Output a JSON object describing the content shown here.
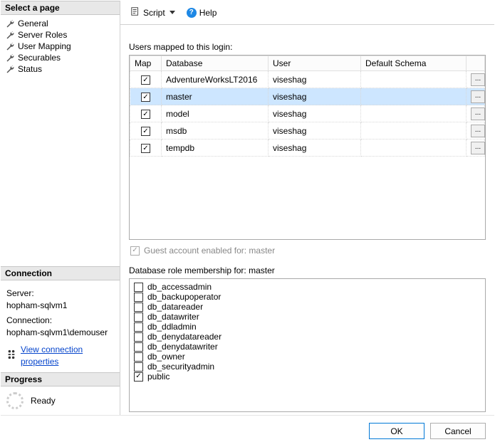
{
  "left": {
    "select_page_header": "Select a page",
    "pages": [
      "General",
      "Server Roles",
      "User Mapping",
      "Securables",
      "Status"
    ],
    "selected_index": 2,
    "connection_header": "Connection",
    "server_label": "Server:",
    "server_value": "hopham-sqlvm1",
    "connection_label": "Connection:",
    "connection_value": "hopham-sqlvm1\\demouser",
    "view_conn_props": "View connection properties",
    "progress_header": "Progress",
    "progress_status": "Ready"
  },
  "toolbar": {
    "script_label": "Script",
    "help_label": "Help"
  },
  "mapping": {
    "label": "Users mapped to this login:",
    "columns": {
      "map": "Map",
      "database": "Database",
      "user": "User",
      "schema": "Default Schema"
    },
    "rows": [
      {
        "checked": true,
        "database": "AdventureWorksLT2016",
        "user": "viseshag",
        "schema": "",
        "selected": false
      },
      {
        "checked": true,
        "database": "master",
        "user": "viseshag",
        "schema": "",
        "selected": true
      },
      {
        "checked": true,
        "database": "model",
        "user": "viseshag",
        "schema": "",
        "selected": false
      },
      {
        "checked": true,
        "database": "msdb",
        "user": "viseshag",
        "schema": "",
        "selected": false
      },
      {
        "checked": true,
        "database": "tempdb",
        "user": "viseshag",
        "schema": "",
        "selected": false
      }
    ],
    "guest_label": "Guest account enabled for: master",
    "guest_checked": true
  },
  "roles": {
    "label": "Database role membership for: master",
    "items": [
      {
        "name": "db_accessadmin",
        "checked": false
      },
      {
        "name": "db_backupoperator",
        "checked": false
      },
      {
        "name": "db_datareader",
        "checked": false
      },
      {
        "name": "db_datawriter",
        "checked": false
      },
      {
        "name": "db_ddladmin",
        "checked": false
      },
      {
        "name": "db_denydatareader",
        "checked": false
      },
      {
        "name": "db_denydatawriter",
        "checked": false
      },
      {
        "name": "db_owner",
        "checked": false
      },
      {
        "name": "db_securityadmin",
        "checked": false
      },
      {
        "name": "public",
        "checked": true
      }
    ]
  },
  "footer": {
    "ok": "OK",
    "cancel": "Cancel"
  }
}
